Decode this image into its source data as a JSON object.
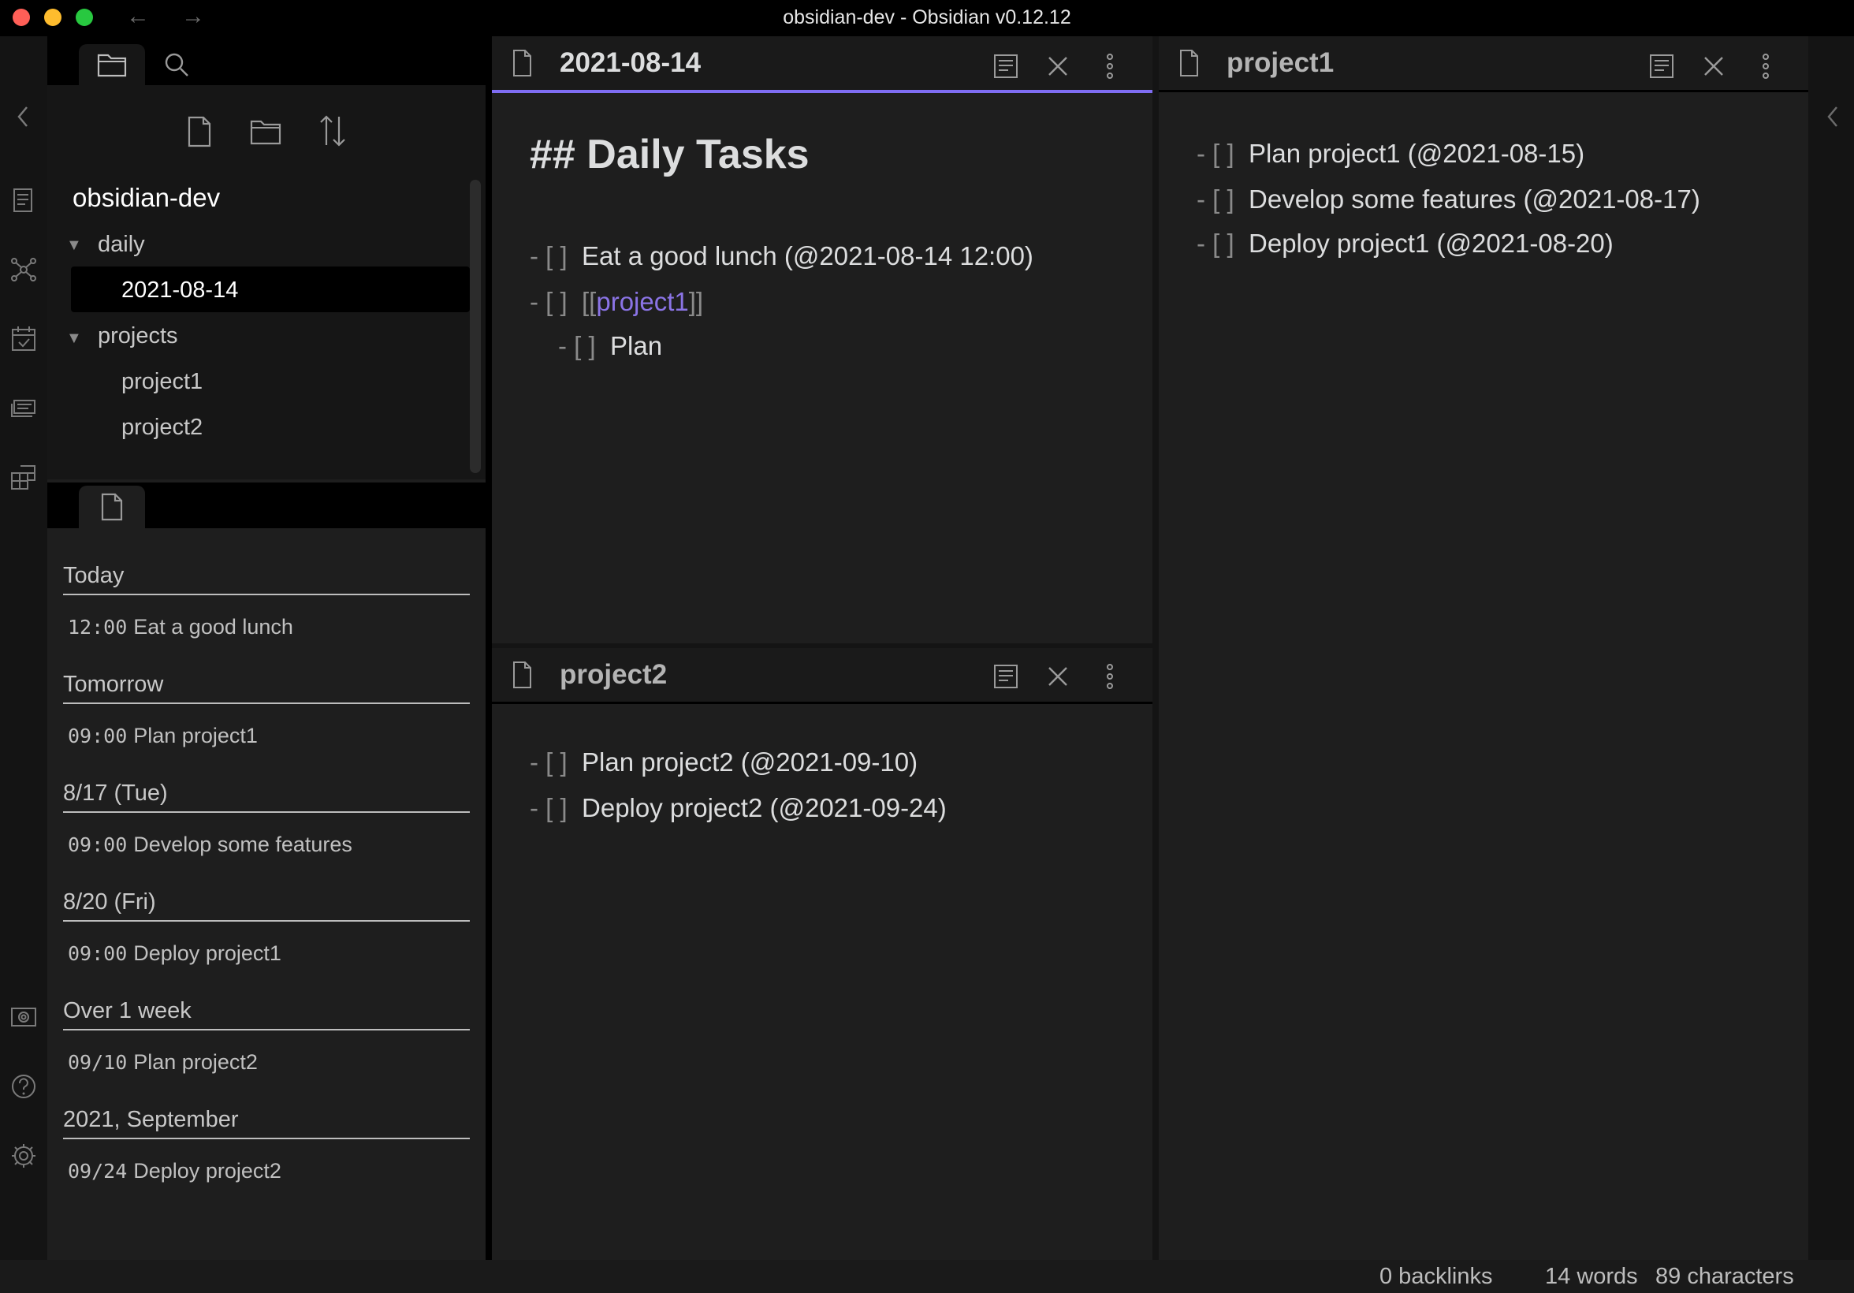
{
  "window": {
    "title": "obsidian-dev - Obsidian v0.12.12",
    "colors": {
      "close": "#ff5f57",
      "minimize": "#febc2e",
      "zoom": "#28c840",
      "accent": "#7f6df2",
      "link": "#8b74e6"
    }
  },
  "ribbon": {
    "icons": [
      "collapse-left-icon",
      "outline-icon",
      "graph-view-icon",
      "calendar-check-icon",
      "slides-icon",
      "table-icon",
      "camera-icon",
      "help-icon",
      "settings-icon"
    ]
  },
  "file_explorer": {
    "toolbar": [
      "new-note-icon",
      "new-folder-icon",
      "sort-icon"
    ],
    "vault_name": "obsidian-dev",
    "tree": {
      "daily": {
        "label": "daily",
        "children": [
          "2021-08-14"
        ]
      },
      "projects": {
        "label": "projects",
        "children": [
          "project1",
          "project2"
        ]
      }
    }
  },
  "events": [
    {
      "header": "Today",
      "time": "12:00",
      "title": "Eat a good lunch"
    },
    {
      "header": "Tomorrow",
      "time": "09:00",
      "title": "Plan project1"
    },
    {
      "header": "8/17 (Tue)",
      "time": "09:00",
      "title": "Develop some features"
    },
    {
      "header": "8/20 (Fri)",
      "time": "09:00",
      "title": "Deploy project1"
    },
    {
      "header": "Over 1 week",
      "time": "09/10",
      "title": "Plan project2"
    },
    {
      "header": "2021, September",
      "time": "09/24",
      "title": "Deploy project2"
    }
  ],
  "panes": {
    "daily": {
      "title": "2021-08-14",
      "heading": "## Daily Tasks",
      "lines": [
        {
          "bullet": "- [ ]",
          "text": "Eat a good lunch (@2021-08-14 12:00)"
        },
        {
          "bullet": "- [ ]",
          "open": "[[",
          "link": "project1",
          "close": "]]"
        },
        {
          "bullet": "- [ ]",
          "text": "Plan"
        }
      ]
    },
    "project2": {
      "title": "project2",
      "lines": [
        {
          "bullet": "- [ ]",
          "text": "Plan project2 (@2021-09-10)"
        },
        {
          "bullet": "- [ ]",
          "text": "Deploy project2 (@2021-09-24)"
        }
      ]
    },
    "project1": {
      "title": "project1",
      "lines": [
        {
          "bullet": "- [ ]",
          "text": "Plan project1 (@2021-08-15)"
        },
        {
          "bullet": "- [ ]",
          "text": "Develop some features (@2021-08-17)"
        },
        {
          "bullet": "- [ ]",
          "text": "Deploy project1 (@2021-08-20)"
        }
      ]
    }
  },
  "status": {
    "backlinks": "0 backlinks",
    "words": "14 words",
    "characters": "89 characters"
  }
}
